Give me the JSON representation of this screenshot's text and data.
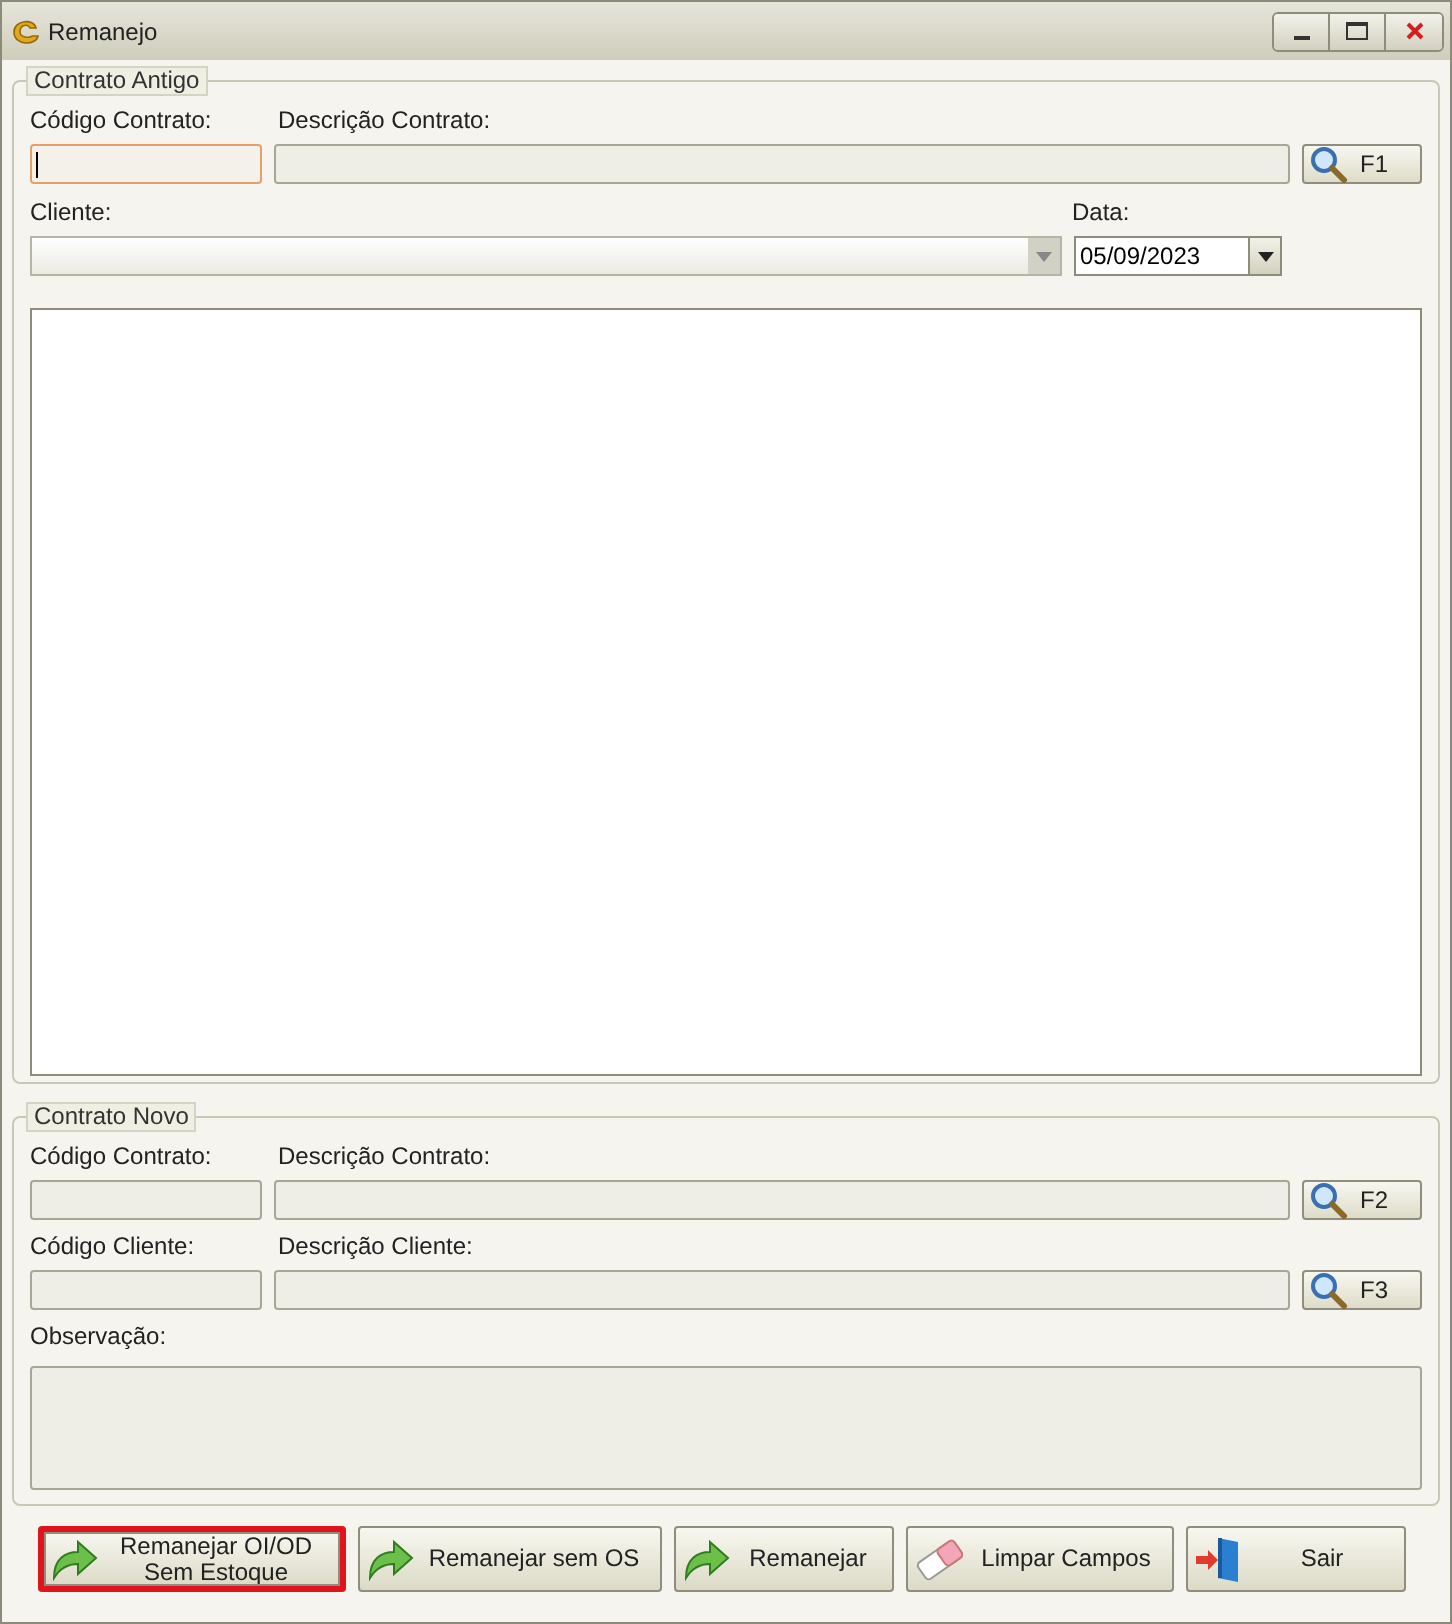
{
  "window": {
    "title": "Remanejo"
  },
  "old_contract": {
    "title": "Contrato Antigo",
    "fields": [
      {
        "label": "Código Contrato:",
        "focused": true
      },
      {
        "label": "Descrição Contrato:",
        "focused": false
      }
    ],
    "search_button": "F1",
    "client": {
      "label": "Cliente:"
    },
    "date": {
      "label": "Data:",
      "value": "05/09/2023"
    }
  },
  "new_contract": {
    "title": "Contrato Novo",
    "rows": [
      {
        "code_label": "Código Contrato:",
        "desc_label": "Descrição Contrato:",
        "search_button": "F2"
      },
      {
        "code_label": "Código Cliente:",
        "desc_label": "Descrição Cliente:",
        "search_button": "F3"
      }
    ],
    "notes": {
      "label": "Observação:"
    }
  },
  "buttons": [
    {
      "label": "Remanejar OI/OD\nSem Estoque",
      "kind": "arrow",
      "highlighted": true
    },
    {
      "label": "Remanejar sem OS",
      "kind": "arrow",
      "highlighted": false
    },
    {
      "label": "Remanejar",
      "kind": "arrow",
      "highlighted": false
    },
    {
      "label": "Limpar Campos",
      "kind": "eraser",
      "highlighted": false
    },
    {
      "label": "Sair",
      "kind": "exit",
      "highlighted": false
    }
  ]
}
